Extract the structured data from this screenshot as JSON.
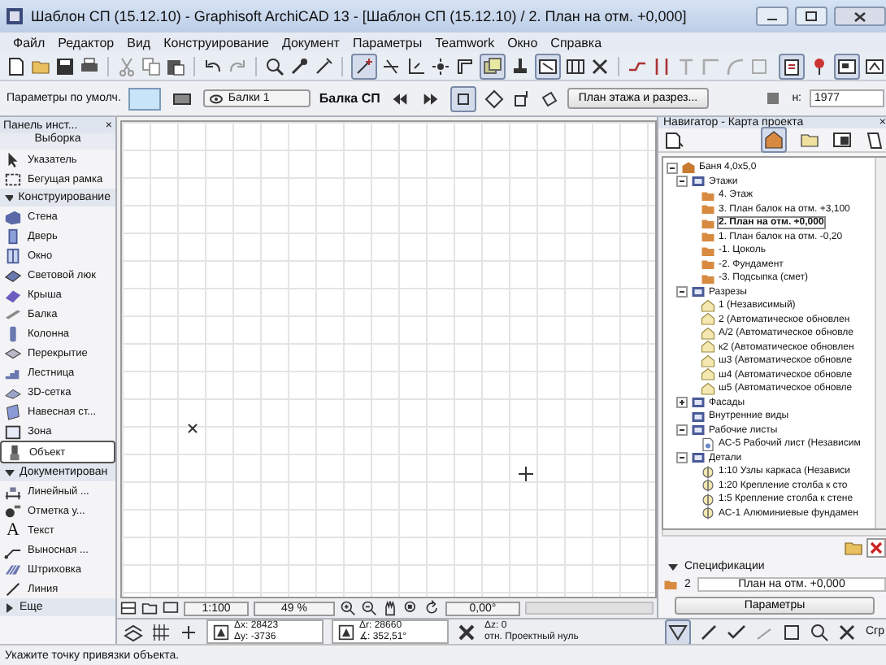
{
  "window": {
    "title": "Шаблон СП (15.12.10) - Graphisoft ArchiCAD 13 - [Шаблон СП (15.12.10) / 2. План на отм. +0,000]"
  },
  "menu": [
    "Файл",
    "Редактор",
    "Вид",
    "Конструирование",
    "Документ",
    "Параметры",
    "Teamwork",
    "Окно",
    "Справка"
  ],
  "info_box": {
    "defaults_label": "Параметры по умолч.",
    "layer": "Балки 1",
    "element_title": "Балка СП",
    "view_button": "План этажа и разрез...",
    "height_label": "н:",
    "height_value": "1977"
  },
  "toolbox": {
    "title": "Панель инст...",
    "close": "×",
    "selection": "Выборка",
    "items": [
      {
        "kind": "tool",
        "label": "Указатель",
        "selected": false
      },
      {
        "kind": "tool",
        "label": "Бегущая рамка",
        "selected": false
      },
      {
        "kind": "section",
        "label": "Конструирование",
        "expanded": true
      },
      {
        "kind": "tool",
        "label": "Стена",
        "selected": false
      },
      {
        "kind": "tool",
        "label": "Дверь",
        "selected": false
      },
      {
        "kind": "tool",
        "label": "Окно",
        "selected": false
      },
      {
        "kind": "tool",
        "label": "Световой люк",
        "selected": false
      },
      {
        "kind": "tool",
        "label": "Крыша",
        "selected": false
      },
      {
        "kind": "tool",
        "label": "Балка",
        "selected": false
      },
      {
        "kind": "tool",
        "label": "Колонна",
        "selected": false
      },
      {
        "kind": "tool",
        "label": "Перекрытие",
        "selected": false
      },
      {
        "kind": "tool",
        "label": "Лестница",
        "selected": false
      },
      {
        "kind": "tool",
        "label": "3D-сетка",
        "selected": false
      },
      {
        "kind": "tool",
        "label": "Навесная ст...",
        "selected": false
      },
      {
        "kind": "tool",
        "label": "Зона",
        "selected": false
      },
      {
        "kind": "tool",
        "label": "Объект",
        "selected": true
      },
      {
        "kind": "section",
        "label": "Документирован",
        "expanded": true
      },
      {
        "kind": "tool",
        "label": "Линейный ...",
        "selected": false
      },
      {
        "kind": "tool",
        "label": "Отметка у...",
        "selected": false
      },
      {
        "kind": "tool",
        "label": "Текст",
        "selected": false,
        "glyph": "A"
      },
      {
        "kind": "tool",
        "label": "Выносная ...",
        "selected": false
      },
      {
        "kind": "tool",
        "label": "Штриховка",
        "selected": false
      },
      {
        "kind": "tool",
        "label": "Линия",
        "selected": false
      },
      {
        "kind": "section",
        "label": "Еще",
        "expanded": false
      }
    ]
  },
  "canvas": {
    "scale": "1:100",
    "zoom": "49 %",
    "angle": "0,00°"
  },
  "navigator": {
    "title": "Навигатор - Карта проекта",
    "close": "×",
    "tree": [
      {
        "label": "Баня 4,0x5,0",
        "kind": "project",
        "expanded": true,
        "selected": false,
        "children": [
          {
            "label": "Этажи",
            "kind": "group",
            "expanded": true,
            "selected": false,
            "children": [
              {
                "label": "4. Этаж",
                "kind": "story",
                "selected": false
              },
              {
                "label": "3. План балок на отм. +3,100",
                "kind": "story",
                "selected": false
              },
              {
                "label": "2. План на отм. +0,000",
                "kind": "story",
                "selected": true
              },
              {
                "label": "1. План балок на отм. -0,20",
                "kind": "story",
                "selected": false
              },
              {
                "label": "-1. Цоколь",
                "kind": "story",
                "selected": false
              },
              {
                "label": "-2. Фундамент",
                "kind": "story",
                "selected": false
              },
              {
                "label": "-3. Подсыпка (смет)",
                "kind": "story",
                "selected": false
              }
            ]
          },
          {
            "label": "Разрезы",
            "kind": "group",
            "expanded": true,
            "selected": false,
            "children": [
              {
                "label": "1 (Независимый)",
                "kind": "section",
                "selected": false
              },
              {
                "label": "2 (Автоматическое обновлен",
                "kind": "section",
                "selected": false
              },
              {
                "label": "А/2 (Автоматическое обновле",
                "kind": "section",
                "selected": false
              },
              {
                "label": "к2 (Автоматическое обновлен",
                "kind": "section",
                "selected": false
              },
              {
                "label": "ш3 (Автоматическое обновле",
                "kind": "section",
                "selected": false
              },
              {
                "label": "ш4 (Автоматическое обновле",
                "kind": "section",
                "selected": false
              },
              {
                "label": "ш5 (Автоматическое обновле",
                "kind": "section",
                "selected": false
              }
            ]
          },
          {
            "label": "Фасады",
            "kind": "group",
            "expanded": false,
            "selected": false
          },
          {
            "label": "Внутренние виды",
            "kind": "group",
            "selected": false
          },
          {
            "label": "Рабочие листы",
            "kind": "group",
            "expanded": true,
            "selected": false,
            "children": [
              {
                "label": "АС-5 Рабочий лист (Независим",
                "kind": "worksheet",
                "selected": false
              }
            ]
          },
          {
            "label": "Детали",
            "kind": "group",
            "expanded": true,
            "selected": false,
            "children": [
              {
                "label": "1:10 Узлы каркаса (Независи",
                "kind": "detail",
                "selected": false
              },
              {
                "label": "1:20 Крепление столба к сто",
                "kind": "detail",
                "selected": false
              },
              {
                "label": "1:5 Крепление столба к стене",
                "kind": "detail",
                "selected": false
              },
              {
                "label": "АС-1 Алюминиевые фундамен",
                "kind": "detail",
                "selected": false
              }
            ]
          }
        ]
      }
    ],
    "schedules_label": "Спецификации",
    "schedules_expanded": true,
    "story_number": "2",
    "story_name": "План на отм. +0,000",
    "settings_button": "Параметры"
  },
  "coordinates": {
    "dx": "Δx: 28423",
    "dy": "Δy: -3736",
    "dr": "Δr: 28660",
    "angle": "∡: 352,51°",
    "dz": "Δz: 0",
    "reference": "отн. Проектный нуль"
  },
  "group_label": "Сгр",
  "status_bar": "Укажите точку привязки объекта."
}
